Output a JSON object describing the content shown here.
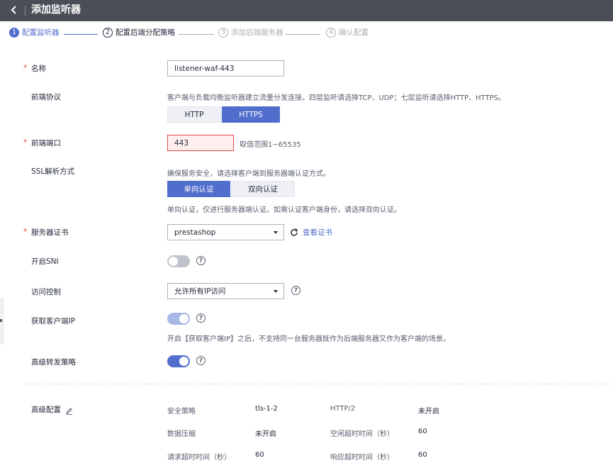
{
  "header": {
    "title": "添加监听器"
  },
  "steps": [
    {
      "num": "1",
      "label": "配置监听器"
    },
    {
      "num": "2",
      "label": "配置后端分配策略"
    },
    {
      "num": "3",
      "label": "添加后端服务器"
    },
    {
      "num": "4",
      "label": "确认配置"
    }
  ],
  "form": {
    "name": {
      "label": "名称",
      "value": "listener-waf-443"
    },
    "protocol": {
      "label": "前端协议",
      "hint": "客户端与负载均衡监听器建立流量分发连接。四层监听请选择TCP、UDP；七层监听请选择HTTP、HTTPS。",
      "options": [
        "HTTP",
        "HTTPS"
      ],
      "selected": "HTTPS"
    },
    "port": {
      "label": "前端端口",
      "value": "443",
      "hint": "取值范围1~65535"
    },
    "ssl": {
      "label": "SSL解析方式",
      "hint": "确保服务安全，请选择客户端到服务器端认证方式。",
      "options": [
        "单向认证",
        "双向认证"
      ],
      "selected": "单向认证",
      "note": "单向认证，仅进行服务器端认证。如需认证客户端身份，请选择双向认证。"
    },
    "cert": {
      "label": "服务器证书",
      "value": "prestashop",
      "link": "查看证书"
    },
    "sni": {
      "label": "开启SNI",
      "enabled": false
    },
    "access": {
      "label": "访问控制",
      "value": "允许所有IP访问"
    },
    "client_ip": {
      "label": "获取客户端IP",
      "enabled": true,
      "note": "开启【获取客户端IP】之后，不支持同一台服务器既作为后端服务器又作为客户端的场景。"
    },
    "forward": {
      "label": "高级转发策略",
      "enabled": true
    }
  },
  "advanced": {
    "label": "高级配置",
    "items": [
      {
        "k": "安全策略",
        "v": "tls-1-2"
      },
      {
        "k": "HTTP/2",
        "v": "未开启"
      },
      {
        "k": "数据压缩",
        "v": "未开启"
      },
      {
        "k": "空闲超时时间（秒）",
        "v": "60"
      },
      {
        "k": "请求超时时间（秒）",
        "v": "60"
      },
      {
        "k": "响应超时时间（秒）",
        "v": "60"
      }
    ]
  },
  "colors": {
    "primary": "#526ecc",
    "error": "#e54545",
    "header": "#4b4e57"
  }
}
